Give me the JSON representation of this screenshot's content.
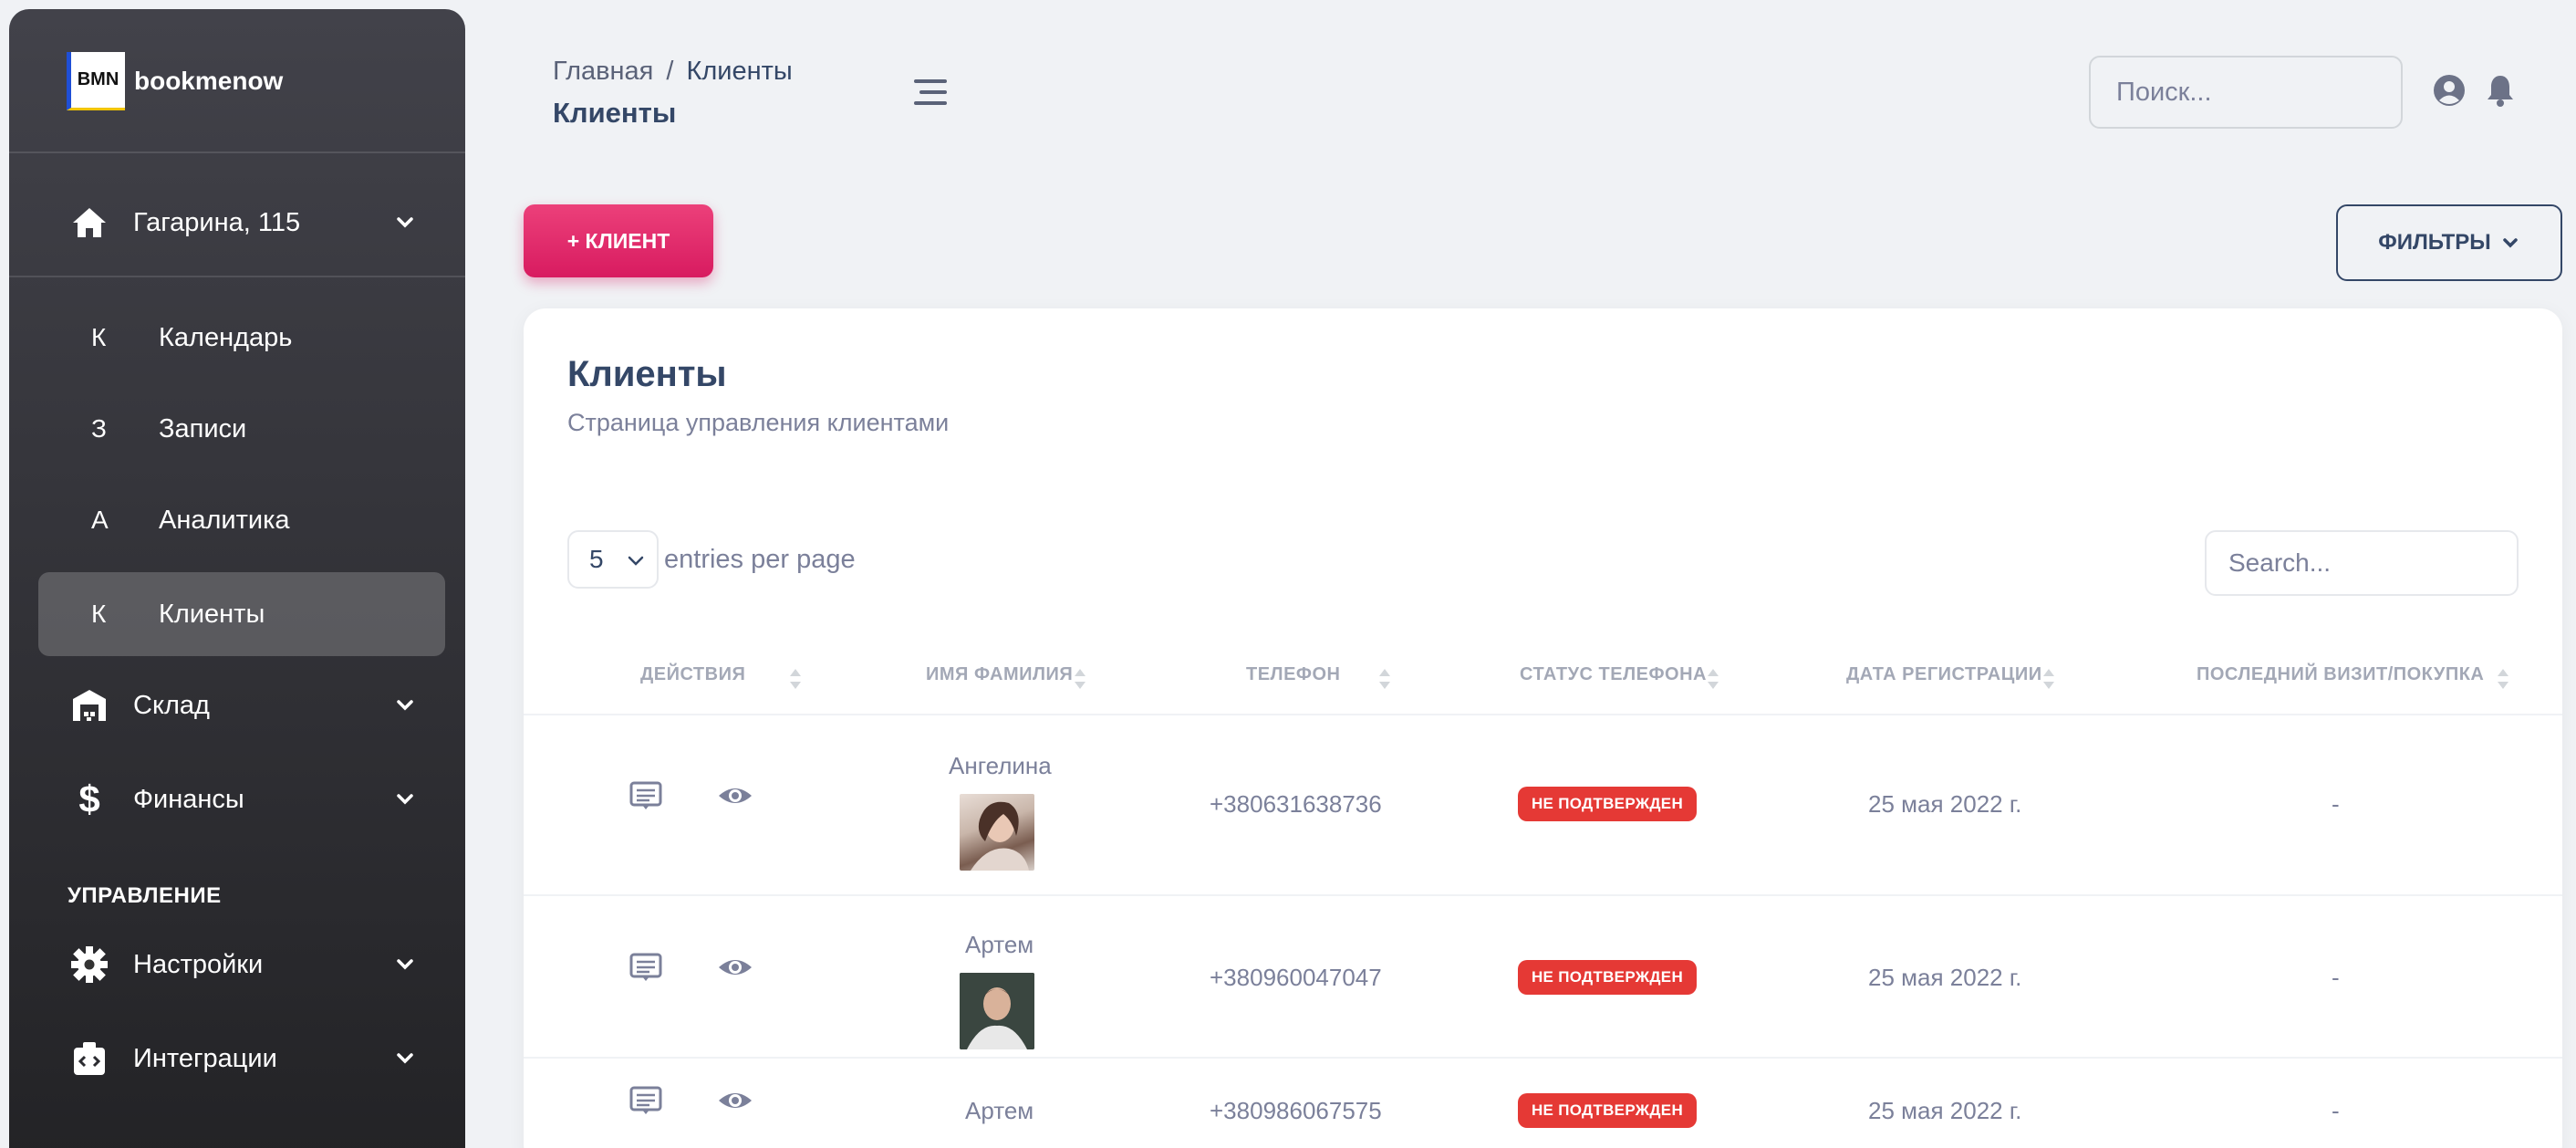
{
  "brand": {
    "logo_text": "BMN",
    "name": "bookmenow"
  },
  "sidebar": {
    "location": {
      "label": "Гагарина, 115",
      "icon": "home-icon"
    },
    "items": [
      {
        "letter": "К",
        "label": "Календарь",
        "active": false
      },
      {
        "letter": "З",
        "label": "Записи",
        "active": false
      },
      {
        "letter": "А",
        "label": "Аналитика",
        "active": false
      },
      {
        "letter": "К",
        "label": "Клиенты",
        "active": true
      }
    ],
    "groups": [
      {
        "label": "Склад",
        "icon": "warehouse-icon"
      },
      {
        "label": "Финансы",
        "icon": "dollar-icon"
      }
    ],
    "section_title": "УПРАВЛЕНИЕ",
    "manage": [
      {
        "label": "Настройки",
        "icon": "gear-icon"
      },
      {
        "label": "Интеграции",
        "icon": "integration-icon"
      }
    ]
  },
  "header": {
    "breadcrumb": {
      "home": "Главная",
      "separator": "/",
      "current": "Клиенты"
    },
    "title": "Клиенты",
    "search_placeholder": "Поиск..."
  },
  "toolbar": {
    "add_label": "+ КЛИЕНТ",
    "filter_label": "ФИЛЬТРЫ"
  },
  "card": {
    "title": "Клиенты",
    "subtitle": "Страница управления клиентами",
    "per_page_value": "5",
    "per_page_label": "entries per page",
    "search_placeholder": "Search..."
  },
  "table": {
    "columns": [
      "ДЕЙСТВИЯ",
      "ИМЯ ФАМИЛИЯ",
      "ТЕЛЕФОН",
      "СТАТУС ТЕЛЕФОНА",
      "ДАТА РЕГИСТРАЦИИ",
      "ПОСЛЕДНИЙ ВИЗИТ/ПОКУПКА"
    ],
    "rows": [
      {
        "name": "Ангелина",
        "phone": "+380631638736",
        "status": "НЕ ПОДТВЕРЖДЕН",
        "registered": "25 мая 2022 г.",
        "last_visit": "-"
      },
      {
        "name": "Артем",
        "phone": "+380960047047",
        "status": "НЕ ПОДТВЕРЖДЕН",
        "registered": "25 мая 2022 г.",
        "last_visit": "-"
      },
      {
        "name": "Артем",
        "phone": "+380986067575",
        "status": "НЕ ПОДТВЕРЖДЕН",
        "registered": "25 мая 2022 г.",
        "last_visit": "-"
      }
    ]
  },
  "colors": {
    "accent": "#d81b60",
    "badge": "#e53935",
    "sidebar_top": "#42424a",
    "sidebar_bottom": "#232326"
  }
}
